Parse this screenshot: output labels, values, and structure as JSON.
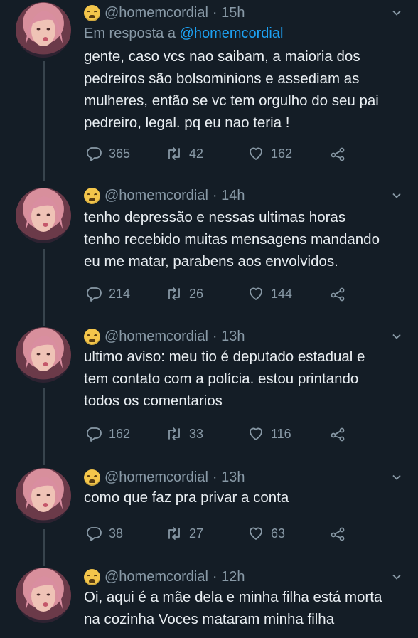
{
  "reply_context": {
    "prefix": "Em resposta a",
    "mention": "@homemcordial"
  },
  "icons": {
    "reply": "reply-icon",
    "retweet": "retweet-icon",
    "like": "heart-icon",
    "share": "share-icon",
    "more": "chevron-down-icon",
    "emoji": "weary-face-emoji"
  },
  "tweets": [
    {
      "handle": "@homemcordial",
      "time": "· 15h",
      "text": "gente, caso vcs nao saibam, a maioria dos\npedreiros são bolsominions e assediam as\nmulheres, então se vc tem orgulho do seu pai\npedreiro, legal. pq eu nao teria !",
      "replies": "365",
      "retweets": "42",
      "likes": "162"
    },
    {
      "handle": "@homemcordial",
      "time": "· 14h",
      "text": "tenho depressão e nessas ultimas horas\ntenho recebido muitas mensagens mandando\neu me matar, parabens aos envolvidos.",
      "replies": "214",
      "retweets": "26",
      "likes": "144"
    },
    {
      "handle": "@homemcordial",
      "time": "· 13h",
      "text": "ultimo aviso: meu tio é deputado estadual e\ntem contato com a polícia. estou printando\ntodos os comentarios",
      "replies": "162",
      "retweets": "33",
      "likes": "116"
    },
    {
      "handle": "@homemcordial",
      "time": "· 13h",
      "text": "como que faz pra privar a conta",
      "replies": "38",
      "retweets": "27",
      "likes": "63"
    },
    {
      "handle": "@homemcordial",
      "time": "· 12h",
      "text": "Oi, aqui é a mãe dela e minha filha está morta\nna cozinha Voces mataram minha filha",
      "replies": "",
      "retweets": "",
      "likes": ""
    }
  ]
}
